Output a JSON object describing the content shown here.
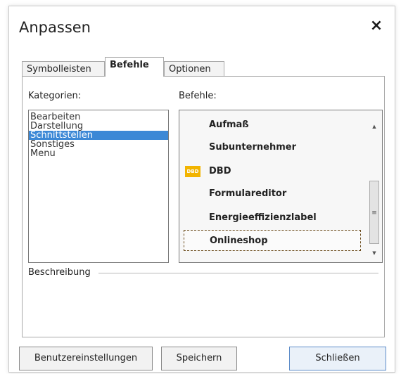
{
  "dialog": {
    "title": "Anpassen",
    "close_symbol": "×"
  },
  "tabs": [
    {
      "label": "Symbolleisten",
      "active": false
    },
    {
      "label": "Befehle",
      "active": true
    },
    {
      "label": "Optionen",
      "active": false
    }
  ],
  "categories": {
    "label": "Kategorien:",
    "items": [
      {
        "label": "Bearbeiten",
        "selected": false
      },
      {
        "label": "Darstellung",
        "selected": false
      },
      {
        "label": "Schnittstellen",
        "selected": true
      },
      {
        "label": "Sonstiges",
        "selected": false
      },
      {
        "label": "Menu",
        "selected": false
      }
    ]
  },
  "commands": {
    "label": "Befehle:",
    "items": [
      {
        "label": "Aufmaß",
        "icon": null,
        "selected": false
      },
      {
        "label": "Subunternehmer",
        "icon": null,
        "selected": false
      },
      {
        "label": "DBD",
        "icon": "dbd-icon",
        "icon_text": "DBD",
        "selected": false
      },
      {
        "label": "Formulareditor",
        "icon": null,
        "selected": false
      },
      {
        "label": "Energieeffizienzlabel",
        "icon": null,
        "selected": false
      },
      {
        "label": "Onlineshop",
        "icon": null,
        "selected": true
      }
    ],
    "scroll": {
      "up": "▲",
      "down": "▼",
      "grip": "≡"
    }
  },
  "description": {
    "label": "Beschreibung"
  },
  "buttons": {
    "user_settings": "Benutzereinstellungen",
    "save": "Speichern",
    "close": "Schließen"
  },
  "colors": {
    "selection": "#3c88d6",
    "dbd_icon": "#f2b400"
  }
}
